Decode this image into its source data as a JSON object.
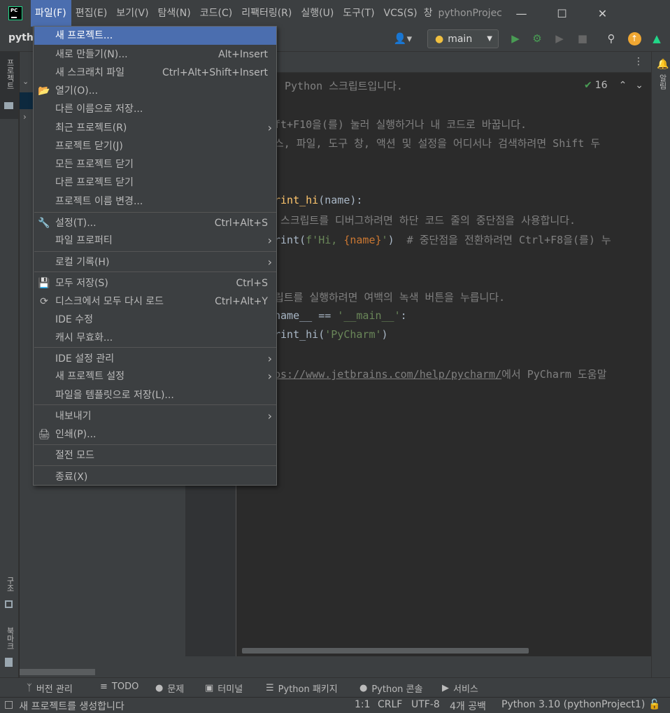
{
  "titlebar": {
    "logo_text": "PC",
    "menus": [
      "파일(F)",
      "편집(E)",
      "보기(V)",
      "탐색(N)",
      "코드(C)",
      "리팩터링(R)",
      "실행(U)",
      "도구(T)",
      "VCS(S)",
      "창"
    ],
    "window_title": "pythonProjec",
    "minimize": "—",
    "maximize": "☐",
    "close": "✕"
  },
  "toolbar": {
    "breadcrumb": "pytho",
    "branch": "main"
  },
  "left_strip": {
    "project_label": "프로젝트",
    "structure_label": "구조",
    "bookmarks_label": "북마크"
  },
  "right_strip": {
    "notifications_label": "알림"
  },
  "editor": {
    "header_text": "Python 스크립트입니다.",
    "inspection_count": "16",
    "lines": [
      {
        "parts": [
          {
            "t": "ft+F10을(를) 눌러 실행하거나 내 코드로 바꿉니다.",
            "c": "comment"
          }
        ]
      },
      {
        "parts": [
          {
            "t": "스, 파일, 도구 창, 액션 및 설정을 어디서나 검색하려면 Shift 두",
            "c": "comment"
          }
        ]
      },
      {
        "parts": [
          {
            "t": "rint_hi",
            "c": "fn"
          },
          {
            "t": "(name):",
            "c": ""
          }
        ]
      },
      {
        "parts": [
          {
            "t": " 스크립트를 디버그하려면 하단 코드 줄의 중단점을 사용합니다.",
            "c": "comment"
          }
        ]
      },
      {
        "parts": [
          {
            "t": "rint(",
            "c": ""
          },
          {
            "t": "f'Hi, ",
            "c": "str"
          },
          {
            "t": "{name}",
            "c": "kw"
          },
          {
            "t": "'",
            "c": "str"
          },
          {
            "t": ")  ",
            "c": ""
          },
          {
            "t": "# 중단점을 전환하려면 Ctrl+F8을(를) 누",
            "c": "comment"
          }
        ]
      },
      {
        "parts": [
          {
            "t": "립트를 실행하려면 여백의 녹색 버튼을 누릅니다.",
            "c": "comment"
          }
        ]
      },
      {
        "parts": [
          {
            "t": "name__ == ",
            "c": ""
          },
          {
            "t": "'__main__'",
            "c": "str"
          },
          {
            "t": ":",
            "c": ""
          }
        ]
      },
      {
        "parts": [
          {
            "t": "rint_hi(",
            "c": ""
          },
          {
            "t": "'PyCharm'",
            "c": "str"
          },
          {
            "t": ")",
            "c": ""
          }
        ]
      },
      {
        "parts": [
          {
            "t": "ps://www.jetbrains.com/help/pycharm/",
            "c": "link"
          },
          {
            "t": "에서 PyCharm 도움말",
            "c": "comment"
          }
        ]
      }
    ]
  },
  "file_menu": {
    "items": [
      {
        "label": "새 프로젝트...",
        "shortcut": "",
        "submenu": false,
        "icon": "",
        "selected": true
      },
      {
        "label": "새로 만들기(N)...",
        "shortcut": "Alt+Insert",
        "submenu": false,
        "icon": ""
      },
      {
        "label": "새 스크래치 파일",
        "shortcut": "Ctrl+Alt+Shift+Insert",
        "submenu": false,
        "icon": ""
      },
      {
        "label": "열기(O)...",
        "shortcut": "",
        "submenu": false,
        "icon": "folder-icon"
      },
      {
        "label": "다른 이름으로 저장...",
        "shortcut": "",
        "submenu": false,
        "icon": ""
      },
      {
        "label": "최근 프로젝트(R)",
        "shortcut": "",
        "submenu": true,
        "icon": ""
      },
      {
        "label": "프로젝트 닫기(J)",
        "shortcut": "",
        "submenu": false,
        "icon": ""
      },
      {
        "label": "모든 프로젝트 닫기",
        "shortcut": "",
        "submenu": false,
        "icon": ""
      },
      {
        "label": "다른 프로젝트 닫기",
        "shortcut": "",
        "submenu": false,
        "icon": ""
      },
      {
        "label": "프로젝트 이름 변경...",
        "shortcut": "",
        "submenu": false,
        "icon": ""
      },
      {
        "label": "설정(T)...",
        "shortcut": "Ctrl+Alt+S",
        "submenu": false,
        "icon": "wrench-icon"
      },
      {
        "label": "파일 프로퍼티",
        "shortcut": "",
        "submenu": true,
        "icon": ""
      },
      {
        "label": "로컬 기록(H)",
        "shortcut": "",
        "submenu": true,
        "icon": ""
      },
      {
        "label": "모두 저장(S)",
        "shortcut": "Ctrl+S",
        "submenu": false,
        "icon": "save-icon"
      },
      {
        "label": "디스크에서 모두 다시 로드",
        "shortcut": "Ctrl+Alt+Y",
        "submenu": false,
        "icon": "reload-icon"
      },
      {
        "label": "IDE 수정",
        "shortcut": "",
        "submenu": false,
        "icon": ""
      },
      {
        "label": "캐시 무효화...",
        "shortcut": "",
        "submenu": false,
        "icon": ""
      },
      {
        "label": "IDE 설정 관리",
        "shortcut": "",
        "submenu": true,
        "icon": ""
      },
      {
        "label": "새 프로젝트 설정",
        "shortcut": "",
        "submenu": true,
        "icon": ""
      },
      {
        "label": "파일을 템플릿으로 저장(L)...",
        "shortcut": "",
        "submenu": false,
        "icon": ""
      },
      {
        "label": "내보내기",
        "shortcut": "",
        "submenu": true,
        "icon": ""
      },
      {
        "label": "인쇄(P)...",
        "shortcut": "",
        "submenu": false,
        "icon": "print-icon"
      },
      {
        "label": "절전 모드",
        "shortcut": "",
        "submenu": false,
        "icon": ""
      },
      {
        "label": "종료(X)",
        "shortcut": "",
        "submenu": false,
        "icon": ""
      }
    ]
  },
  "bottom_tools": [
    "버전 관리",
    "TODO",
    "문제",
    "터미널",
    "Python 패키지",
    "Python 콘솔",
    "서비스"
  ],
  "status": {
    "message": "새 프로젝트를 생성합니다",
    "position": "1:1",
    "line_sep": "CRLF",
    "encoding": "UTF-8",
    "indent": "4개 공백",
    "interpreter": "Python 3.10 (pythonProject1)"
  },
  "colors": {
    "accent": "#4b6eaf",
    "run_green": "#499c54",
    "brand_green": "#21d789"
  }
}
